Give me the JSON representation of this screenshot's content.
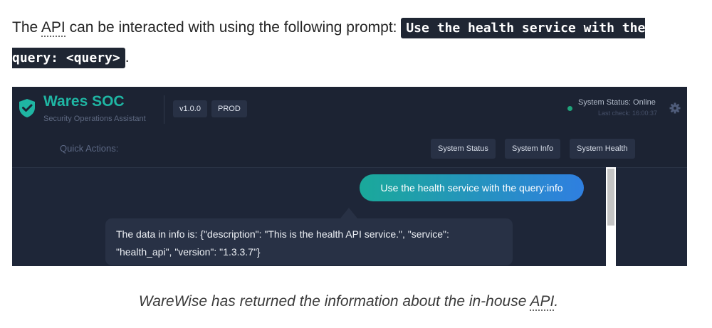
{
  "intro": {
    "text_before": "The ",
    "abbr": "API",
    "text_after": " can be interacted with using the following prompt: ",
    "code": "Use the health service with the query: <query>",
    "end": "."
  },
  "app": {
    "brand": "Wares SOC",
    "tagline": "Security Operations Assistant",
    "version": "v1.0.0",
    "env": "PROD",
    "status_text": "System Status: Online",
    "last_check": "Last check: 16:00:37",
    "status_color": "#1fa37a",
    "accent_color": "#1fb5a3",
    "icons": [
      "shield-check-icon",
      "gear-icon"
    ],
    "quick_actions_label": "Quick Actions:",
    "quick_actions": [
      "System Status",
      "System Info",
      "System Health"
    ]
  },
  "chat": {
    "user_message": "Use the health service with the query:info",
    "bot_line1": "The data in info is: {\"description\": \"This is the health API service.\", \"service\":",
    "bot_line2": "\"health_api\", \"version\": \"1.3.3.7\"}"
  },
  "caption": {
    "text_before": "WareWise has returned the information about the in-house ",
    "abbr": "API",
    "end": "."
  }
}
